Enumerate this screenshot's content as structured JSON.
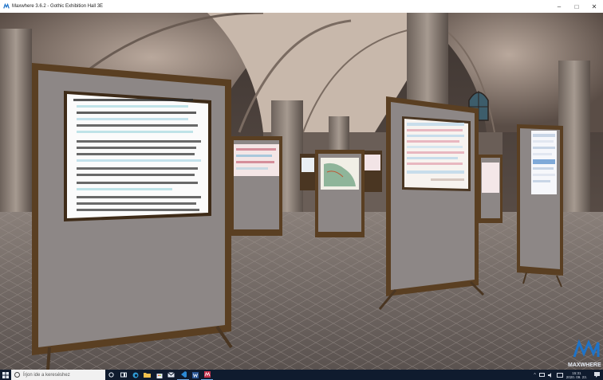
{
  "window": {
    "title": "Maxwhere 3.6.2 - Gothic Exhibition Hall 3E",
    "controls": {
      "minimize": "–",
      "maximize": "□",
      "close": "✕"
    }
  },
  "scene": {
    "logo_text": "MAXWHERE"
  },
  "taskbar": {
    "search_placeholder": "Írjon ide a kereséshez",
    "clock_time": "15:31",
    "clock_date": "2020. 09. 23.",
    "apps": [
      "task-view-icon",
      "cortana-icon",
      "edge-icon",
      "file-explorer-icon",
      "store-icon",
      "mail-icon",
      "vscode-icon",
      "word-icon",
      "maxwhere-icon"
    ]
  },
  "colors": {
    "taskbar": "#0f1b2e",
    "panel_frame": "#5a3f22",
    "panel_board": "#8d8786",
    "floor": "#6e6460",
    "accent": "#1e73c8"
  }
}
